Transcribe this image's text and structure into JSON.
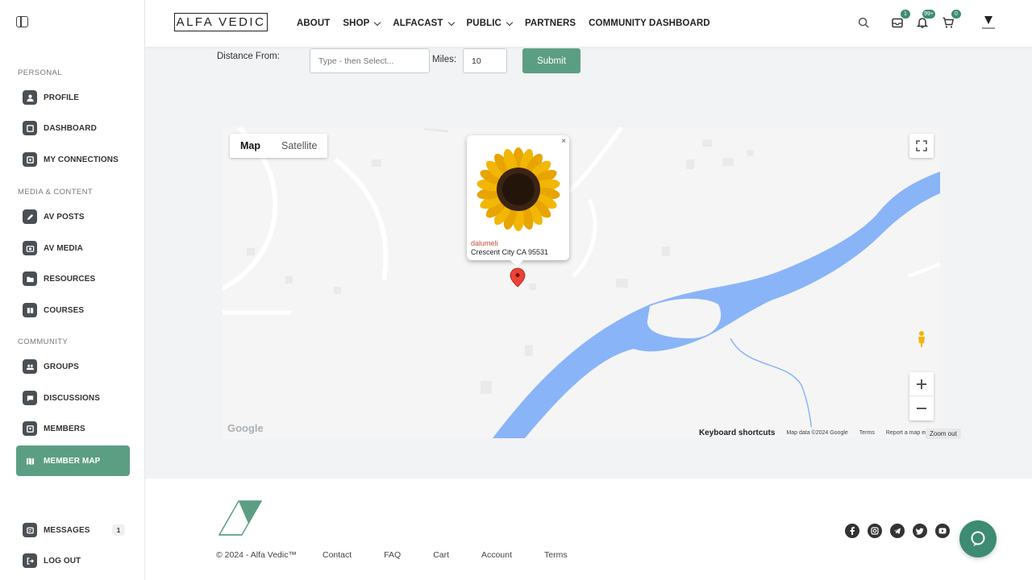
{
  "sidebar": {
    "sections": [
      {
        "label": "PERSONAL"
      },
      {
        "label": "MEDIA & CONTENT"
      },
      {
        "label": "COMMUNITY"
      }
    ],
    "items": [
      {
        "label": "PROFILE",
        "icon": "user-icon"
      },
      {
        "label": "DASHBOARD",
        "icon": "dashboard-icon"
      },
      {
        "label": "MY CONNECTIONS",
        "icon": "connections-icon"
      },
      {
        "label": "AV POSTS",
        "icon": "pencil-icon"
      },
      {
        "label": "AV MEDIA",
        "icon": "camera-icon"
      },
      {
        "label": "RESOURCES",
        "icon": "folder-icon"
      },
      {
        "label": "COURSES",
        "icon": "book-icon"
      },
      {
        "label": "GROUPS",
        "icon": "groups-icon"
      },
      {
        "label": "DISCUSSIONS",
        "icon": "chat-icon"
      },
      {
        "label": "MEMBERS",
        "icon": "members-icon"
      },
      {
        "label": "MEMBER MAP",
        "icon": "map-icon",
        "active": true
      },
      {
        "label": "MESSAGES",
        "icon": "message-icon",
        "badge": "1"
      },
      {
        "label": "LOG OUT",
        "icon": "logout-icon"
      }
    ]
  },
  "header": {
    "logo_text": "ALFA VEDIC",
    "nav": [
      {
        "label": "ABOUT",
        "dropdown": false
      },
      {
        "label": "SHOP",
        "dropdown": true
      },
      {
        "label": "ALFACAST",
        "dropdown": true
      },
      {
        "label": "PUBLIC",
        "dropdown": true
      },
      {
        "label": "PARTNERS",
        "dropdown": false
      },
      {
        "label": "COMMUNITY DASHBOARD",
        "dropdown": false
      }
    ],
    "inbox_badge": "1",
    "notifications_badge": "99+",
    "cart_badge": "0",
    "accent": "#3d8b73"
  },
  "search_form": {
    "distance_label": "Distance From:",
    "distance_placeholder": "Type - then Select...",
    "miles_label": "Miles:",
    "miles_value": "10",
    "submit_label": "Submit",
    "button_color": "#5c9e84"
  },
  "map": {
    "type_map": "Map",
    "type_satellite": "Satellite",
    "info_name": "dalumeli",
    "info_location": "Crescent City CA 95531",
    "close_glyph": "×",
    "google_logo": "Google",
    "keyboard_shortcuts": "Keyboard shortcuts",
    "map_data": "Map data ©2024 Google",
    "terms": "Terms",
    "report": "Report a map error",
    "zoom_tooltip": "Zoom out",
    "water_color": "#8ab4f8"
  },
  "footer": {
    "copyright": "© 2024 - Alfa Vedic™",
    "links": [
      "Contact",
      "FAQ",
      "Cart",
      "Account",
      "Terms"
    ],
    "socials": [
      "facebook-icon",
      "instagram-icon",
      "telegram-icon",
      "twitter-icon",
      "youtube-icon"
    ]
  }
}
